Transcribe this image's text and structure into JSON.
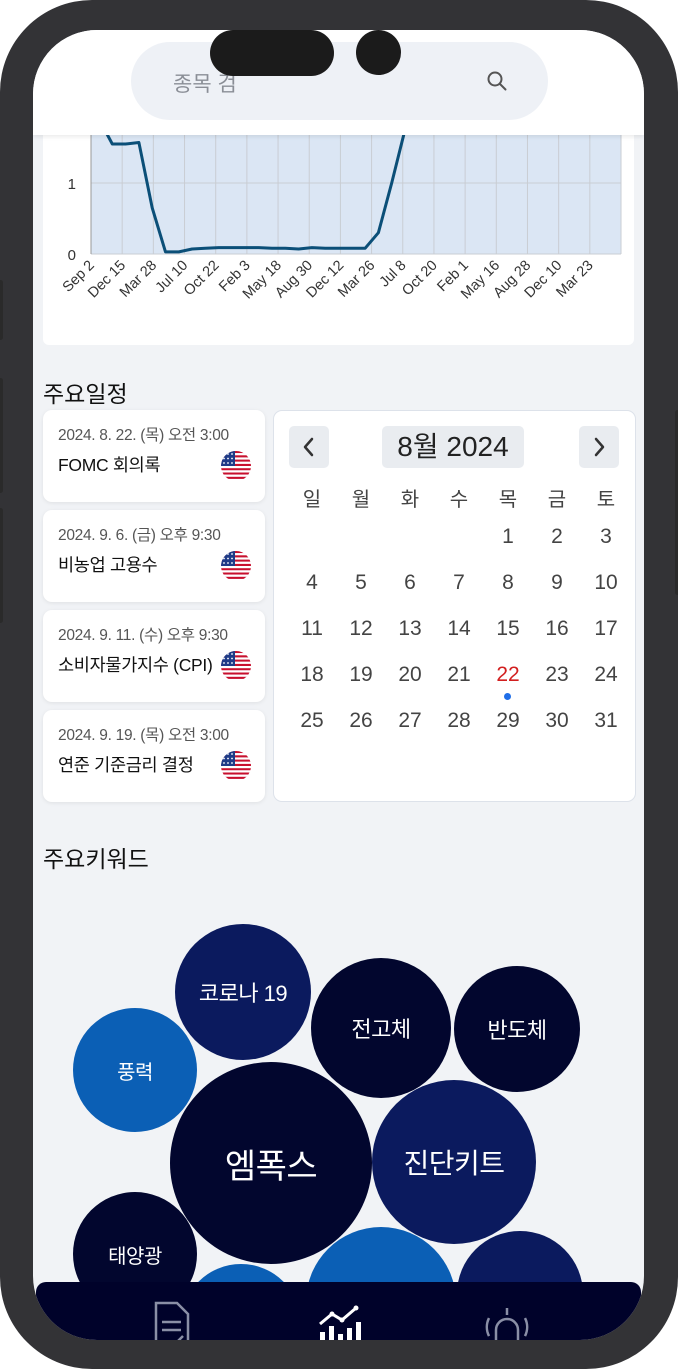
{
  "search": {
    "placeholder": "종목 검"
  },
  "chart_data": {
    "type": "line",
    "x_ticks": [
      "Sep 2",
      "Dec 15",
      "Mar 28",
      "Jul 10",
      "Oct 22",
      "Feb 3",
      "May 18",
      "Aug 30",
      "Dec 12",
      "Mar 26",
      "Jul 8",
      "Oct 20",
      "Feb 1",
      "May 16",
      "Aug 28",
      "Dec 10",
      "Mar 23"
    ],
    "y_ticks": [
      0,
      1
    ],
    "series": [
      {
        "values": [
          1.9,
          1.55,
          1.55,
          1.57,
          0.65,
          0.03,
          0.03,
          0.07,
          0.08,
          0.09,
          0.09,
          0.09,
          0.09,
          0.08,
          0.08,
          0.07,
          0.09,
          0.08,
          0.08,
          0.08,
          0.08,
          0.3,
          1.0,
          1.75
        ]
      }
    ],
    "series_color": "#0b4f78",
    "fill_color": "#dbe6f4",
    "grid": true
  },
  "schedule": {
    "title": "주요일정",
    "events": [
      {
        "date": "2024. 8. 22. (목) 오전 3:00",
        "name": "FOMC 회의록"
      },
      {
        "date": "2024. 9. 6. (금) 오후 9:30",
        "name": "비농업 고용수"
      },
      {
        "date": "2024. 9. 11. (수) 오후 9:30",
        "name": "소비자물가지수 (CPI)"
      },
      {
        "date": "2024. 9. 19. (목) 오전 3:00",
        "name": "연준 기준금리 결정"
      }
    ]
  },
  "calendar": {
    "month_label": "8월 2024",
    "weekdays": [
      "일",
      "월",
      "화",
      "수",
      "목",
      "금",
      "토"
    ],
    "days": [
      [
        "",
        "",
        "",
        "",
        "1",
        "2",
        "3"
      ],
      [
        "4",
        "5",
        "6",
        "7",
        "8",
        "9",
        "10"
      ],
      [
        "11",
        "12",
        "13",
        "14",
        "15",
        "16",
        "17"
      ],
      [
        "18",
        "19",
        "20",
        "21",
        "22",
        "23",
        "24"
      ],
      [
        "25",
        "26",
        "27",
        "28",
        "29",
        "30",
        "31"
      ]
    ],
    "today": "22",
    "today_color": "#d21f1f",
    "event_dot_color": "#1f6ee8"
  },
  "keywords": {
    "title": "주요키워드",
    "bubbles": [
      {
        "label": "코로나 19",
        "color": "#0b1a5e"
      },
      {
        "label": "전고체",
        "color": "#02062e"
      },
      {
        "label": "반도체",
        "color": "#02062e"
      },
      {
        "label": "풍력",
        "color": "#0b5fb5"
      },
      {
        "label": "엠폭스",
        "color": "#02062e"
      },
      {
        "label": "진단키트",
        "color": "#0b1a5e"
      },
      {
        "label": "태양광",
        "color": "#02062e"
      },
      {
        "label": "",
        "color": "#0b5fb5"
      },
      {
        "label": "",
        "color": "#0b5fb5"
      },
      {
        "label": "",
        "color": "#0b1a5e"
      }
    ]
  },
  "bottom_nav": {
    "items": [
      {
        "icon": "document-check-icon"
      },
      {
        "icon": "bar-chart-trend-icon"
      },
      {
        "icon": "alarm-bell-icon"
      }
    ],
    "background": "#00022a"
  }
}
